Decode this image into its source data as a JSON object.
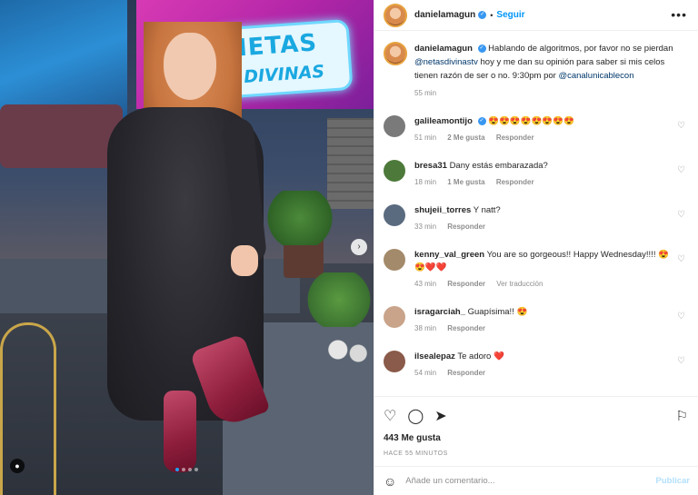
{
  "photo": {
    "sign_line1": "NETAS",
    "sign_line2": "DIVINAS",
    "next_icon": "chevron-right-icon",
    "user_tag_icon": "user-icon",
    "carousel": {
      "count": 4,
      "active": 1
    }
  },
  "header": {
    "username": "danielamagun",
    "verified_icon": "check-icon",
    "separator": "•",
    "follow_label": "Seguir",
    "more_label": "•••"
  },
  "caption": {
    "username": "danielamagun",
    "text_a": "Hablando de algoritmos, por favor no se pierdan ",
    "mention1": "@netasdivinastv",
    "text_b": " hoy y me dan su opinión para saber si mis celos tienen razón de ser o no. 9:30pm por ",
    "mention2": "@canalunicablecon",
    "time": "55 min"
  },
  "comments": [
    {
      "username": "galileamontijo",
      "verified": true,
      "text": "😍😍😍😍😍😍😍😍",
      "time": "51 min",
      "likes": "2 Me gusta",
      "reply": "Responder",
      "extra": "",
      "avatar_color": "#7a7a7a"
    },
    {
      "username": "bresa31",
      "verified": false,
      "text": "Dany estás embarazada?",
      "time": "18 min",
      "likes": "1 Me gusta",
      "reply": "Responder",
      "extra": "",
      "avatar_color": "#4d7a3a"
    },
    {
      "username": "shujeii_torres",
      "verified": false,
      "text": "Y natt?",
      "time": "33 min",
      "likes": "",
      "reply": "Responder",
      "extra": "",
      "avatar_color": "#5a6b80"
    },
    {
      "username": "kenny_val_green",
      "verified": false,
      "text": "You are so gorgeous!! Happy Wednesday!!!! 😍😍❤️❤️",
      "time": "43 min",
      "likes": "",
      "reply": "Responder",
      "extra": "Ver traducción",
      "avatar_color": "#a38a6a"
    },
    {
      "username": "isragarciah_",
      "verified": false,
      "text": "Guapísima!! 😍",
      "time": "38 min",
      "likes": "",
      "reply": "Responder",
      "extra": "",
      "avatar_color": "#c9a48a"
    },
    {
      "username": "ilsealepaz",
      "verified": false,
      "text": "Te adoro ❤️",
      "time": "54 min",
      "likes": "",
      "reply": "Responder",
      "extra": "",
      "avatar_color": "#8a5a4a"
    }
  ],
  "actions": {
    "like_icon": "heart-icon",
    "comment_icon": "comment-icon",
    "share_icon": "send-icon",
    "save_icon": "bookmark-icon",
    "likes_count": "443 Me gusta",
    "post_time": "HACE 55 MINUTOS"
  },
  "add_comment": {
    "emoji_icon": "smiley-icon",
    "placeholder": "Añade un comentario...",
    "publish_label": "Publicar"
  },
  "colors": {
    "link": "#0095f6",
    "mention": "#00376b",
    "muted": "#8e8e8e",
    "heart": "#ed4956"
  }
}
